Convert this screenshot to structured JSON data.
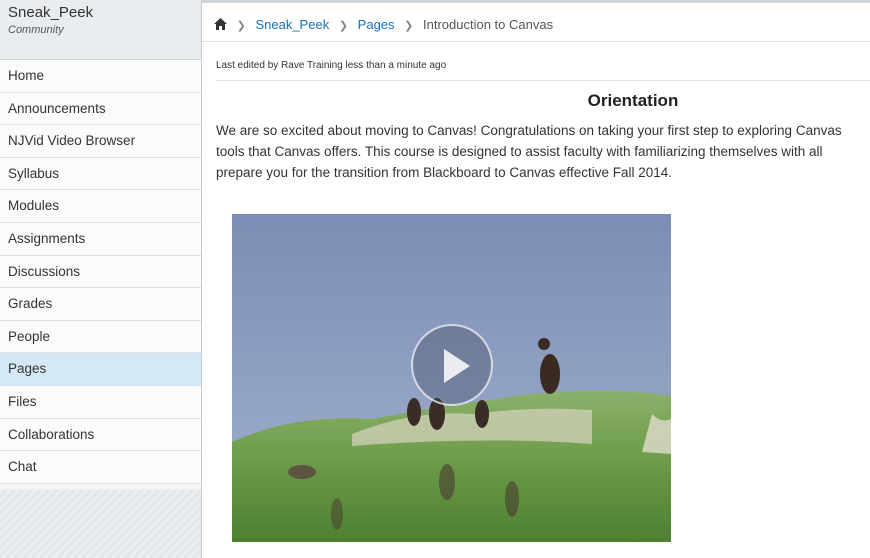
{
  "sidebar": {
    "course_name": "Sneak_Peek",
    "course_sub": "Community",
    "items": [
      {
        "label": "Home",
        "active": false
      },
      {
        "label": "Announcements",
        "active": false
      },
      {
        "label": "NJVid Video Browser",
        "active": false
      },
      {
        "label": "Syllabus",
        "active": false
      },
      {
        "label": "Modules",
        "active": false
      },
      {
        "label": "Assignments",
        "active": false
      },
      {
        "label": "Discussions",
        "active": false
      },
      {
        "label": "Grades",
        "active": false
      },
      {
        "label": "People",
        "active": false
      },
      {
        "label": "Pages",
        "active": true
      },
      {
        "label": "Files",
        "active": false
      },
      {
        "label": "Collaborations",
        "active": false
      },
      {
        "label": "Chat",
        "active": false
      }
    ]
  },
  "breadcrumb": {
    "home_icon": "home-icon",
    "items": [
      "Sneak_Peek",
      "Pages"
    ],
    "current": "Introduction to Canvas"
  },
  "page": {
    "edited": "Last edited by Rave Training less than a minute ago",
    "heading": "Orientation",
    "intro_lines": [
      "We are so excited about moving to Canvas! Congratulations on taking your first step to exploring Canvas",
      "tools that Canvas offers.  This course is designed to assist faculty with familiarizing themselves with all",
      "prepare you for the transition from Blackboard to Canvas effective Fall 2014."
    ]
  },
  "video": {
    "play_icon": "play-icon"
  },
  "colors": {
    "link": "#1a6fb6",
    "active_nav": "#d5e8f5"
  }
}
